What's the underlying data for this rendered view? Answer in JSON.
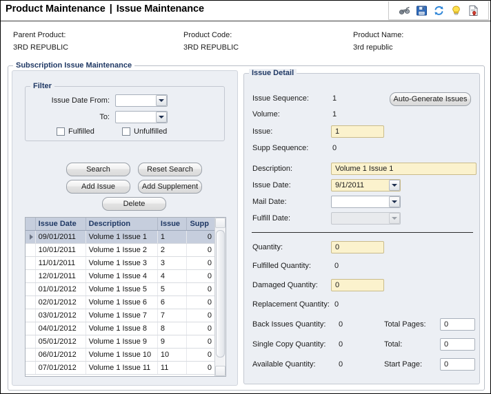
{
  "window": {
    "title_primary": "Product Maintenance",
    "title_separator": "|",
    "title_secondary": "Issue Maintenance"
  },
  "toolbar": {
    "icons": [
      {
        "name": "binoculars-icon",
        "label": "View"
      },
      {
        "name": "save-icon",
        "label": "Save"
      },
      {
        "name": "refresh-icon",
        "label": "Refresh"
      },
      {
        "name": "lightbulb-icon",
        "label": "Hint"
      },
      {
        "name": "report-icon",
        "label": "Report"
      }
    ]
  },
  "product_info": {
    "parent_product_label": "Parent Product:",
    "parent_product_value": "3RD REPUBLIC",
    "product_code_label": "Product Code:",
    "product_code_value": "3RD REPUBLIC",
    "product_name_label": "Product Name:",
    "product_name_value": "3rd republic"
  },
  "subscription_group": {
    "legend": "Subscription Issue Maintenance"
  },
  "filter": {
    "legend": "Filter",
    "issue_date_from_label": "Issue Date From:",
    "issue_date_from_value": "",
    "to_label": "To:",
    "to_value": "",
    "fulfilled_label": "Fulfilled",
    "fulfilled_checked": false,
    "unfulfilled_label": "Unfulfilled",
    "unfulfilled_checked": false
  },
  "actions": {
    "search": "Search",
    "reset_search": "Reset Search",
    "add_issue": "Add Issue",
    "add_supplement": "Add Supplement",
    "delete": "Delete"
  },
  "grid": {
    "columns": [
      "Issue Date",
      "Description",
      "Issue",
      "Supp"
    ],
    "selected_row_index": 0,
    "rows": [
      {
        "date": "09/01/2011",
        "description": "Volume 1 Issue 1",
        "issue": "1",
        "supp": "0"
      },
      {
        "date": "10/01/2011",
        "description": "Volume 1 Issue 2",
        "issue": "2",
        "supp": "0"
      },
      {
        "date": "11/01/2011",
        "description": "Volume 1 Issue 3",
        "issue": "3",
        "supp": "0"
      },
      {
        "date": "12/01/2011",
        "description": "Volume 1 Issue 4",
        "issue": "4",
        "supp": "0"
      },
      {
        "date": "01/01/2012",
        "description": "Volume 1 Issue 5",
        "issue": "5",
        "supp": "0"
      },
      {
        "date": "02/01/2012",
        "description": "Volume 1 Issue 6",
        "issue": "6",
        "supp": "0"
      },
      {
        "date": "03/01/2012",
        "description": "Volume 1 Issue 7",
        "issue": "7",
        "supp": "0"
      },
      {
        "date": "04/01/2012",
        "description": "Volume 1 Issue 8",
        "issue": "8",
        "supp": "0"
      },
      {
        "date": "05/01/2012",
        "description": "Volume 1 Issue 9",
        "issue": "9",
        "supp": "0"
      },
      {
        "date": "06/01/2012",
        "description": "Volume 1 Issue 10",
        "issue": "10",
        "supp": "0"
      },
      {
        "date": "07/01/2012",
        "description": "Volume 1 Issue 11",
        "issue": "11",
        "supp": "0"
      }
    ]
  },
  "detail": {
    "legend": "Issue Detail",
    "auto_generate_button": "Auto-Generate Issues",
    "issue_sequence_label": "Issue Sequence:",
    "issue_sequence_value": "1",
    "volume_label": "Volume:",
    "volume_value": "1",
    "issue_label": "Issue:",
    "issue_value": "1",
    "supp_sequence_label": "Supp Sequence:",
    "supp_sequence_value": "0",
    "description_label": "Description:",
    "description_value": "Volume 1 Issue 1",
    "issue_date_label": "Issue Date:",
    "issue_date_value": "9/1/2011",
    "mail_date_label": "Mail Date:",
    "mail_date_value": "",
    "fulfill_date_label": "Fulfill Date:",
    "fulfill_date_value": "",
    "quantity_label": "Quantity:",
    "quantity_value": "0",
    "fulfilled_quantity_label": "Fulfilled Quantity:",
    "fulfilled_quantity_value": "0",
    "damaged_quantity_label": "Damaged Quantity:",
    "damaged_quantity_value": "0",
    "replacement_quantity_label": "Replacement Quantity:",
    "replacement_quantity_value": "0",
    "back_issues_quantity_label": "Back Issues Quantity:",
    "back_issues_quantity_value": "0",
    "single_copy_quantity_label": "Single Copy Quantity:",
    "single_copy_quantity_value": "0",
    "available_quantity_label": "Available Quantity:",
    "available_quantity_value": "0",
    "total_pages_label": "Total Pages:",
    "total_pages_value": "0",
    "total_label": "Total:",
    "total_value": "0",
    "start_page_label": "Start Page:",
    "start_page_value": "0"
  }
}
